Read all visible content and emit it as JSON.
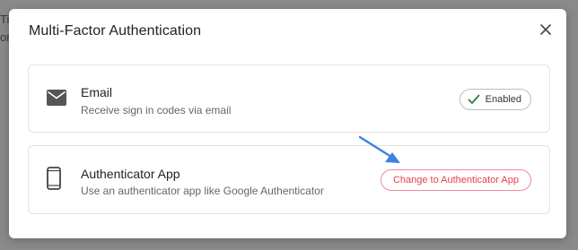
{
  "backdrop": {
    "line1": "Tit",
    "line2": "or"
  },
  "modal": {
    "title": "Multi-Factor Authentication",
    "close_icon": "close-icon"
  },
  "methods": [
    {
      "icon": "mail-icon",
      "title": "Email",
      "description": "Receive sign in codes via email",
      "status_label": "Enabled",
      "status_icon": "check-icon"
    },
    {
      "icon": "phone-icon",
      "title": "Authenticator App",
      "description": "Use an authenticator app like Google Authenticator",
      "action_label": "Change to Authenticator App"
    }
  ],
  "annotation": {
    "icon": "pointer-arrow-icon",
    "color": "#3b82e0"
  },
  "colors": {
    "accent_red": "#e5404f",
    "accent_red_border": "#f08a94",
    "enabled_check": "#2e7d32"
  }
}
